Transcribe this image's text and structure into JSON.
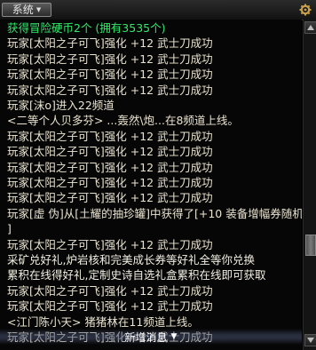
{
  "header": {
    "tab_label": "系统"
  },
  "chat": {
    "lines": [
      {
        "text": "获得冒险硬币2个 (拥有3535个)",
        "color": "green"
      },
      {
        "text": "玩家[太阳之子可飞]强化 +12 武士刀成功",
        "color": "normal"
      },
      {
        "text": "玩家[太阳之子可飞]强化 +12 武士刀成功",
        "color": "normal"
      },
      {
        "text": "玩家[太阳之子可飞]强化 +12 武士刀成功",
        "color": "normal"
      },
      {
        "text": "玩家[太阳之子可飞]强化 +12 武士刀成功",
        "color": "normal"
      },
      {
        "text": "玩家[沫o]进入22频道",
        "color": "normal"
      },
      {
        "text": "<二等个人贝多芬> ...轰然\\炮...在8频道上线。",
        "color": "normal"
      },
      {
        "text": "玩家[太阳之子可飞]强化 +12 武士刀成功",
        "color": "normal"
      },
      {
        "text": "玩家[太阳之子可飞]强化 +12 武士刀成功",
        "color": "normal"
      },
      {
        "text": "玩家[太阳之子可飞]强化 +12 武士刀成功",
        "color": "normal"
      },
      {
        "text": "玩家[太阳之子可飞]强化 +12 武士刀成功",
        "color": "normal"
      },
      {
        "text": "玩家[太阳之子可飞]强化 +12 武士刀成功",
        "color": "normal"
      },
      {
        "text": "玩家[虚 伪]从[土耀的抽珍罐]中获得了[+10 装备增幅券随机礼盒",
        "color": "normal"
      },
      {
        "text": "]",
        "color": "normal"
      },
      {
        "text": "玩家[太阳之子可飞]强化 +12 武士刀成功",
        "color": "normal"
      },
      {
        "text": "采矿兑好礼,炉岩核和完美成长券等好礼全等你兑换",
        "color": "white"
      },
      {
        "text": "累积在线得好礼,定制史诗自选礼盒累积在线即可获取",
        "color": "white"
      },
      {
        "text": "玩家[太阳之子可飞]强化 +12 武士刀成功",
        "color": "normal"
      },
      {
        "text": "玩家[太阳之子可飞]强化 +12 武士刀成功",
        "color": "normal"
      },
      {
        "text": "<江门陈小天> 猪猪林在11频道上线。",
        "color": "normal"
      },
      {
        "text": "玩家[太阳之子可飞]强化 +12 武士刀成功",
        "color": "normal"
      }
    ]
  },
  "new_message": {
    "label": "新增消息"
  },
  "icons": {
    "tab_arrow": "triangle-down-icon",
    "settings": "gear-icon",
    "scroll_up": "triangle-up-icon",
    "scroll_down": "triangle-down-icon",
    "new_message_arrow": "arrow-down-icon"
  },
  "colors": {
    "system_green": "#31e86a",
    "text": "#e9e3cf"
  }
}
